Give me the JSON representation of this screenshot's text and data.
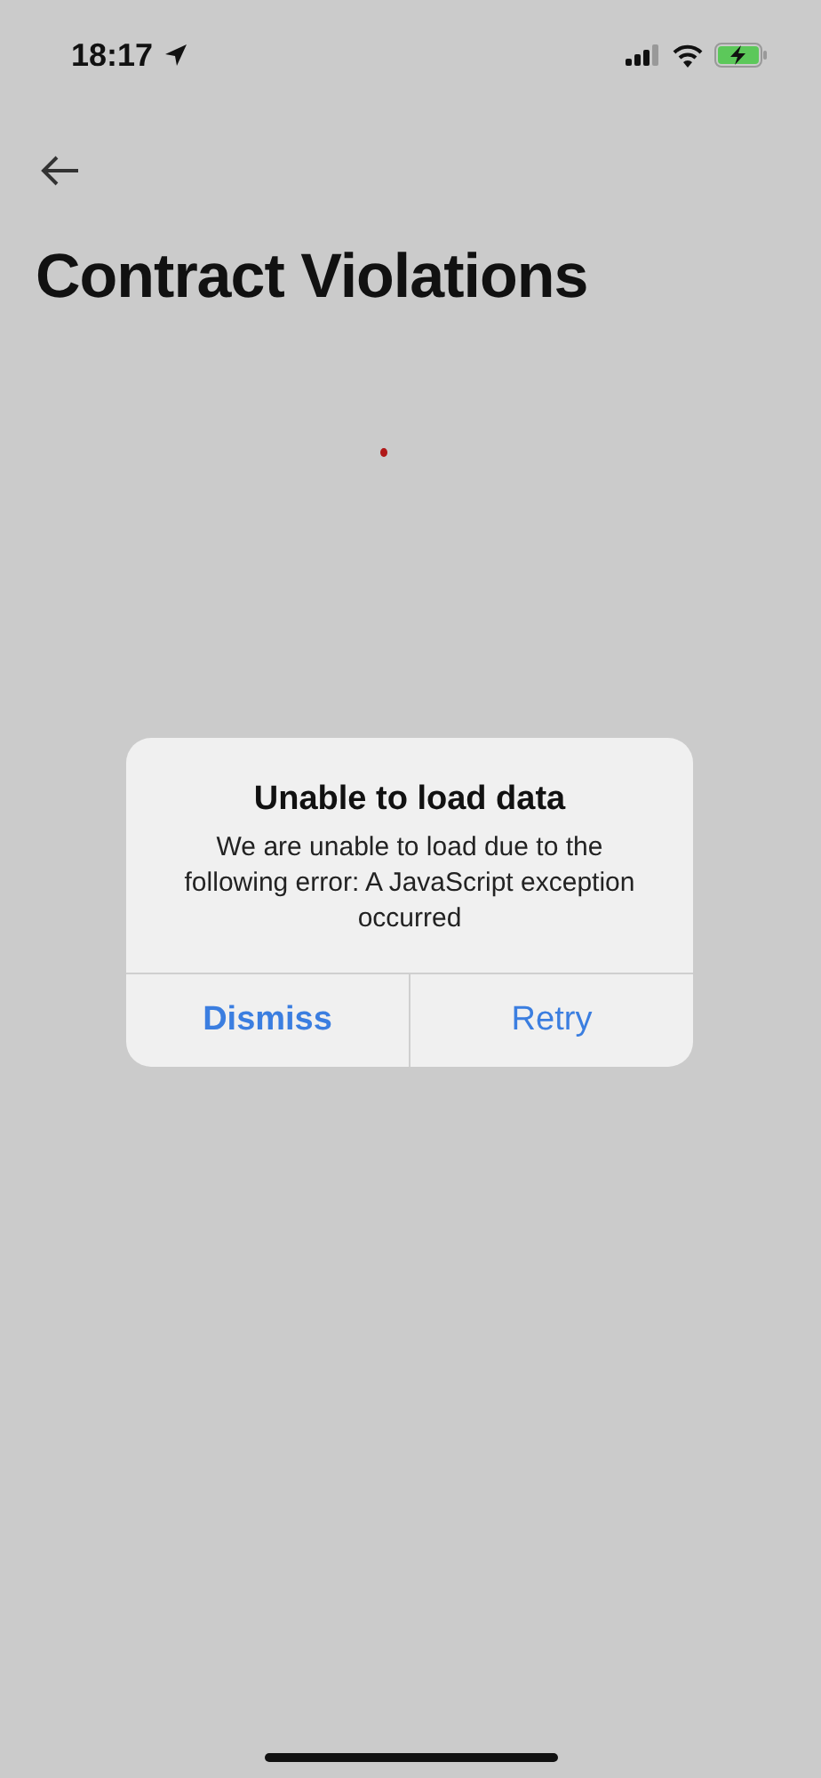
{
  "status_bar": {
    "time": "18:17",
    "battery_charging": true
  },
  "header": {
    "title": "Contract Violations"
  },
  "alert": {
    "title": "Unable to load data",
    "message": "We are unable to load due to the following error: A JavaScript exception occurred",
    "buttons": [
      {
        "label": "Dismiss",
        "preferred": true
      },
      {
        "label": "Retry",
        "preferred": false
      }
    ]
  }
}
